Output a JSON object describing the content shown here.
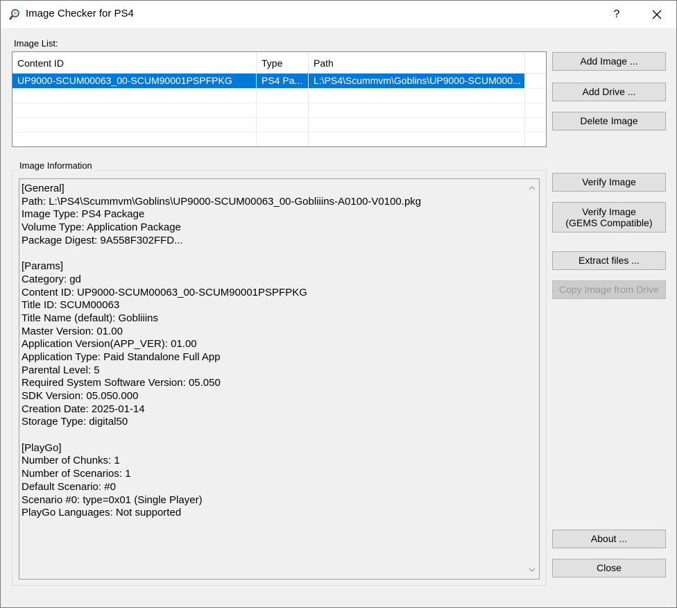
{
  "window": {
    "title": "Image Checker for PS4",
    "help": "?",
    "icon": "magnifier-icon"
  },
  "image_list": {
    "label": "Image List:",
    "columns": [
      "Content ID",
      "Type",
      "Path"
    ],
    "rows": [
      {
        "content_id": "UP9000-SCUM00063_00-SCUM90001PSPFPKG",
        "type": "PS4 Pa...",
        "path": "L:\\PS4\\Scummvm\\Goblins\\UP9000-SCUM000..."
      }
    ]
  },
  "image_info": {
    "label": "Image Information",
    "lines": [
      "[General]",
      "Path: L:\\PS4\\Scummvm\\Goblins\\UP9000-SCUM00063_00-Gobliiins-A0100-V0100.pkg",
      "Image Type: PS4 Package",
      "Volume Type: Application Package",
      "Package Digest: 9A558F302FFD...",
      "",
      "[Params]",
      "Category: gd",
      "Content ID: UP9000-SCUM00063_00-SCUM90001PSPFPKG",
      "Title ID: SCUM00063",
      "Title Name (default): Gobliiins",
      "Master Version: 01.00",
      "Application Version(APP_VER): 01.00",
      "Application Type: Paid Standalone Full App",
      "Parental Level: 5",
      "Required System Software Version: 05.050",
      "SDK Version: 05.050.000",
      "Creation Date: 2025-01-14",
      "Storage Type: digital50",
      "",
      "[PlayGo]",
      "Number of Chunks: 1",
      "Number of Scenarios: 1",
      "Default Scenario: #0",
      "Scenario #0: type=0x01 (Single Player)",
      "PlayGo Languages: Not supported"
    ]
  },
  "buttons": {
    "add_image": "Add Image ...",
    "add_drive": "Add Drive ...",
    "delete_image": "Delete Image",
    "verify_image": "Verify Image",
    "verify_gems_line1": "Verify Image",
    "verify_gems_line2": "(GEMS Compatible)",
    "extract_files": "Extract files ...",
    "copy_from_drive": "Copy Image from Drive",
    "about": "About ...",
    "close": "Close"
  }
}
